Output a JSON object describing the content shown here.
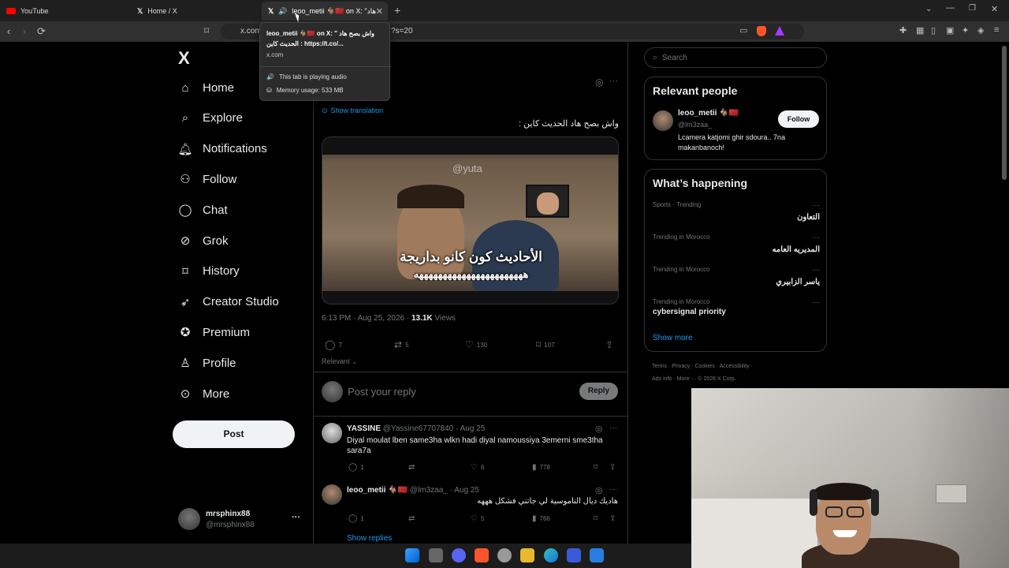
{
  "browser": {
    "tabs": [
      {
        "title": "YouTube"
      },
      {
        "title": "Home / X"
      },
      {
        "title": "leoo_metii 🐐🇲🇦 on X: \"واش بصح هاد"
      }
    ],
    "url_start": "x.com",
    "url_end": "?s=20",
    "tooltip": {
      "title": "leoo_metii 🐐🇲🇦 on X: \" واش بصح هاد الحديث كاين : https://t.co/...",
      "domain": "x.com",
      "audio": "This tab is playing audio",
      "memory": "Memory usage: 533 MB"
    }
  },
  "sidebar": {
    "logo": "X",
    "items": [
      {
        "label": "Home",
        "icon": "home-icon"
      },
      {
        "label": "Explore",
        "icon": "search-icon"
      },
      {
        "label": "Notifications",
        "icon": "bell-icon"
      },
      {
        "label": "Follow",
        "icon": "person-plus-icon"
      },
      {
        "label": "Chat",
        "icon": "chat-icon"
      },
      {
        "label": "Grok",
        "icon": "grok-icon"
      },
      {
        "label": "History",
        "icon": "bookmark-icon"
      },
      {
        "label": "Creator Studio",
        "icon": "rocket-icon"
      },
      {
        "label": "Premium",
        "icon": "verified-icon"
      },
      {
        "label": "Profile",
        "icon": "person-icon"
      },
      {
        "label": "More",
        "icon": "more-circle-icon"
      }
    ],
    "post_button": "Post",
    "account": {
      "name": "mrsphinx88",
      "handle": "@mrsphinx88",
      "more": "···"
    }
  },
  "tweet": {
    "show_translation": "Show translation",
    "text": "واش بصح هاد الحديث كاين :",
    "media": {
      "watermark": "@yuta",
      "caption_line1": "الأحاديث كون كانو بداريجة",
      "caption_line2": "هههههههههههههههههههههههه"
    },
    "timestamp": "6:13 PM · Aug 25, 2026 · ",
    "views_count": "13.1K",
    "views_label": " Views",
    "replies": "7",
    "reposts": "5",
    "likes": "130",
    "bookmarks": "107",
    "sort": "Relevant",
    "reply_placeholder": "Post your reply",
    "reply_button": "Reply"
  },
  "replies": [
    {
      "name": "YASSINE",
      "handle": "@Yassine67707840",
      "date": "· Aug 25",
      "text": "Diyal moulat lben same3ha wlkn hadi diyal namoussiya 3emerni sme3tha sara7a",
      "replies": "1",
      "reposts": "",
      "likes": "6",
      "views": "778"
    },
    {
      "name": "leoo_metii 🐐🇲🇦",
      "handle": "@lm3zaa_",
      "date": "· Aug 25",
      "text": "هاديك ديال الناموسية لي جاتني فشكل هههه",
      "replies": "1",
      "reposts": "",
      "likes": "5",
      "views": "766"
    }
  ],
  "show_replies": "Show replies",
  "right": {
    "search_placeholder": "Search",
    "relevant_title": "Relevant people",
    "person": {
      "name": "leoo_metii 🐐🇲🇦",
      "handle": "@lm3zaa_",
      "bio": "Lcamera katjomi ghir sdoura.. 7na makanbanoch!",
      "follow": "Follow"
    },
    "happening_title": "What’s happening",
    "trends": [
      {
        "category": "Sports · Trending",
        "name": "التعاون"
      },
      {
        "category": "Trending in Morocco",
        "name": "المديريه العامه"
      },
      {
        "category": "Trending in Morocco",
        "name": "ياسر الزابيري"
      },
      {
        "category": "Trending in Morocco",
        "name": "cybersignal priority"
      }
    ],
    "show_more": "Show more",
    "footer_line1": "Terms ·   Privacy ·   Cookies ·   Accessibility ·",
    "footer_line2": "Ads info ·   More ···   © 2026 X Corp."
  },
  "colors": {
    "accent": "#1d9bf0",
    "background": "#000000",
    "border": "#2f3336"
  }
}
